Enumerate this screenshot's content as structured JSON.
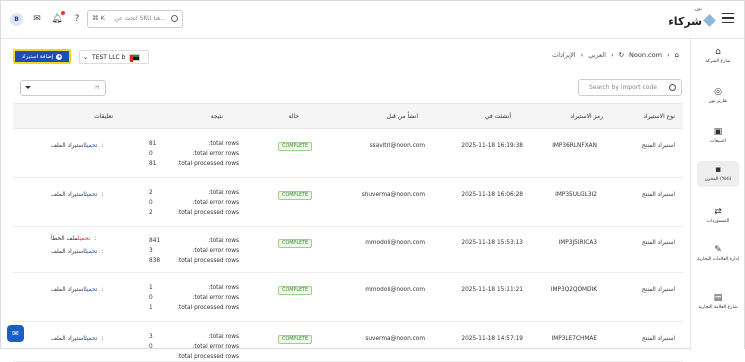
{
  "topbar": {
    "logo_small": "نون",
    "logo_main": "شركاء",
    "search_placeholder": "ابحث عن SKU هنا...",
    "search_shortcut": "⌘ K",
    "avatar_initial": "B"
  },
  "sidebar": {
    "items": [
      {
        "label": "شارع الشركة",
        "icon": "store-icon"
      },
      {
        "label": "تقارير نون",
        "icon": "chart-icon"
      },
      {
        "label": "المبيعات",
        "icon": "bag-icon"
      },
      {
        "label": "المخزن (Yeti)",
        "icon": "warehouse-icon"
      },
      {
        "label": "المستوردات",
        "icon": "import-icon"
      },
      {
        "label": "إدارة العلامات التجارية",
        "icon": "brand-icon"
      },
      {
        "label": "شارع العلامة التجارية",
        "icon": "shop-icon"
      }
    ]
  },
  "header": {
    "breadcrumb": [
      "Noon.com",
      "العربي",
      "الإيرادات"
    ],
    "add_button": "إضافة استيراد",
    "company": "TEST LLC b"
  },
  "filters": {
    "search_placeholder": "Search by import code",
    "select_value": "H"
  },
  "table": {
    "columns": {
      "type": "نوع الاستيراد",
      "code": "رمز الاستيراد",
      "created_at": "أنشئت في",
      "created_by": "انشأ من قبل",
      "status": "حالة",
      "result": "نتيجة",
      "comments": "تعليقات"
    },
    "labels": {
      "total_rows": ":total rows",
      "total_error_rows": ":total error rows",
      "total_processed_rows": ":total processed rows"
    },
    "rows": [
      {
        "type": "استيراد المنتج",
        "code": "IMP36RLNFXAN",
        "created_at": "2025-11-18 16:19:38",
        "created_by": "ssavitri@noon.com",
        "status": "COMPLETE",
        "total_rows": "81",
        "total_error_rows": "0",
        "total_processed_rows": "81",
        "comments": [
          {
            "label": "استيراد الملف:",
            "link": "تحميل",
            "error": false
          }
        ]
      },
      {
        "type": "استيراد المنتج",
        "code": "IMP35ULGL3I2",
        "created_at": "2025-11-18 16:06:28",
        "created_by": "shuverma@noon.com",
        "status": "COMPLETE",
        "total_rows": "2",
        "total_error_rows": "0",
        "total_processed_rows": "2",
        "comments": [
          {
            "label": "استيراد الملف:",
            "link": "تحميل",
            "error": false
          }
        ]
      },
      {
        "type": "استيراد المنتج",
        "code": "IMP3J5IRICA3",
        "created_at": "2025-11-18 15:53:13",
        "created_by": "mmodoli@noon.com",
        "status": "COMPLETE",
        "total_rows": "841",
        "total_error_rows": "3",
        "total_processed_rows": "838",
        "comments": [
          {
            "label": "ملف الخطأ:",
            "link": "تحميل",
            "error": true
          },
          {
            "label": "استيراد الملف:",
            "link": "تحميل",
            "error": false
          }
        ]
      },
      {
        "type": "استيراد المنتج",
        "code": "IMP3Q2QOMDIK",
        "created_at": "2025-11-18 15:11:21",
        "created_by": "mmodoli@noon.com",
        "status": "COMPLETE",
        "total_rows": "1",
        "total_error_rows": "0",
        "total_processed_rows": "1",
        "comments": [
          {
            "label": "استيراد الملف:",
            "link": "تحميل",
            "error": false
          }
        ]
      },
      {
        "type": "استيراد المنتج",
        "code": "IMP3LE7CHMAE",
        "created_at": "2025-11-18 14:57:19",
        "created_by": "suverma@noon.com",
        "status": "COMPLETE",
        "total_rows": "3",
        "total_error_rows": "0",
        "total_processed_rows": "",
        "comments": [
          {
            "label": "استيراد الملف:",
            "link": "تحميل",
            "error": false
          }
        ]
      }
    ]
  },
  "colors": {
    "primary": "#1a4fb8",
    "highlight_border": "#f1d51a",
    "complete_green": "#3b8f2b",
    "link_blue": "#1a56c4",
    "error_red": "#d32f2f"
  }
}
